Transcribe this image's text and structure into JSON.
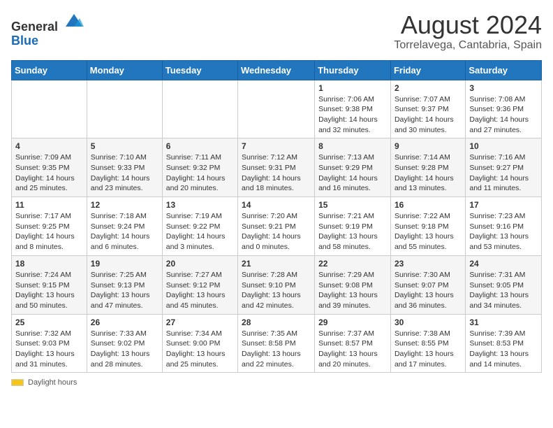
{
  "logo": {
    "general": "General",
    "blue": "Blue"
  },
  "title": "August 2024",
  "subtitle": "Torrelavega, Cantabria, Spain",
  "headers": [
    "Sunday",
    "Monday",
    "Tuesday",
    "Wednesday",
    "Thursday",
    "Friday",
    "Saturday"
  ],
  "footer": {
    "daylight_label": "Daylight hours"
  },
  "weeks": [
    [
      {
        "day": "",
        "info": ""
      },
      {
        "day": "",
        "info": ""
      },
      {
        "day": "",
        "info": ""
      },
      {
        "day": "",
        "info": ""
      },
      {
        "day": "1",
        "info": "Sunrise: 7:06 AM\nSunset: 9:38 PM\nDaylight: 14 hours\nand 32 minutes."
      },
      {
        "day": "2",
        "info": "Sunrise: 7:07 AM\nSunset: 9:37 PM\nDaylight: 14 hours\nand 30 minutes."
      },
      {
        "day": "3",
        "info": "Sunrise: 7:08 AM\nSunset: 9:36 PM\nDaylight: 14 hours\nand 27 minutes."
      }
    ],
    [
      {
        "day": "4",
        "info": "Sunrise: 7:09 AM\nSunset: 9:35 PM\nDaylight: 14 hours\nand 25 minutes."
      },
      {
        "day": "5",
        "info": "Sunrise: 7:10 AM\nSunset: 9:33 PM\nDaylight: 14 hours\nand 23 minutes."
      },
      {
        "day": "6",
        "info": "Sunrise: 7:11 AM\nSunset: 9:32 PM\nDaylight: 14 hours\nand 20 minutes."
      },
      {
        "day": "7",
        "info": "Sunrise: 7:12 AM\nSunset: 9:31 PM\nDaylight: 14 hours\nand 18 minutes."
      },
      {
        "day": "8",
        "info": "Sunrise: 7:13 AM\nSunset: 9:29 PM\nDaylight: 14 hours\nand 16 minutes."
      },
      {
        "day": "9",
        "info": "Sunrise: 7:14 AM\nSunset: 9:28 PM\nDaylight: 14 hours\nand 13 minutes."
      },
      {
        "day": "10",
        "info": "Sunrise: 7:16 AM\nSunset: 9:27 PM\nDaylight: 14 hours\nand 11 minutes."
      }
    ],
    [
      {
        "day": "11",
        "info": "Sunrise: 7:17 AM\nSunset: 9:25 PM\nDaylight: 14 hours\nand 8 minutes."
      },
      {
        "day": "12",
        "info": "Sunrise: 7:18 AM\nSunset: 9:24 PM\nDaylight: 14 hours\nand 6 minutes."
      },
      {
        "day": "13",
        "info": "Sunrise: 7:19 AM\nSunset: 9:22 PM\nDaylight: 14 hours\nand 3 minutes."
      },
      {
        "day": "14",
        "info": "Sunrise: 7:20 AM\nSunset: 9:21 PM\nDaylight: 14 hours\nand 0 minutes."
      },
      {
        "day": "15",
        "info": "Sunrise: 7:21 AM\nSunset: 9:19 PM\nDaylight: 13 hours\nand 58 minutes."
      },
      {
        "day": "16",
        "info": "Sunrise: 7:22 AM\nSunset: 9:18 PM\nDaylight: 13 hours\nand 55 minutes."
      },
      {
        "day": "17",
        "info": "Sunrise: 7:23 AM\nSunset: 9:16 PM\nDaylight: 13 hours\nand 53 minutes."
      }
    ],
    [
      {
        "day": "18",
        "info": "Sunrise: 7:24 AM\nSunset: 9:15 PM\nDaylight: 13 hours\nand 50 minutes."
      },
      {
        "day": "19",
        "info": "Sunrise: 7:25 AM\nSunset: 9:13 PM\nDaylight: 13 hours\nand 47 minutes."
      },
      {
        "day": "20",
        "info": "Sunrise: 7:27 AM\nSunset: 9:12 PM\nDaylight: 13 hours\nand 45 minutes."
      },
      {
        "day": "21",
        "info": "Sunrise: 7:28 AM\nSunset: 9:10 PM\nDaylight: 13 hours\nand 42 minutes."
      },
      {
        "day": "22",
        "info": "Sunrise: 7:29 AM\nSunset: 9:08 PM\nDaylight: 13 hours\nand 39 minutes."
      },
      {
        "day": "23",
        "info": "Sunrise: 7:30 AM\nSunset: 9:07 PM\nDaylight: 13 hours\nand 36 minutes."
      },
      {
        "day": "24",
        "info": "Sunrise: 7:31 AM\nSunset: 9:05 PM\nDaylight: 13 hours\nand 34 minutes."
      }
    ],
    [
      {
        "day": "25",
        "info": "Sunrise: 7:32 AM\nSunset: 9:03 PM\nDaylight: 13 hours\nand 31 minutes."
      },
      {
        "day": "26",
        "info": "Sunrise: 7:33 AM\nSunset: 9:02 PM\nDaylight: 13 hours\nand 28 minutes."
      },
      {
        "day": "27",
        "info": "Sunrise: 7:34 AM\nSunset: 9:00 PM\nDaylight: 13 hours\nand 25 minutes."
      },
      {
        "day": "28",
        "info": "Sunrise: 7:35 AM\nSunset: 8:58 PM\nDaylight: 13 hours\nand 22 minutes."
      },
      {
        "day": "29",
        "info": "Sunrise: 7:37 AM\nSunset: 8:57 PM\nDaylight: 13 hours\nand 20 minutes."
      },
      {
        "day": "30",
        "info": "Sunrise: 7:38 AM\nSunset: 8:55 PM\nDaylight: 13 hours\nand 17 minutes."
      },
      {
        "day": "31",
        "info": "Sunrise: 7:39 AM\nSunset: 8:53 PM\nDaylight: 13 hours\nand 14 minutes."
      }
    ]
  ]
}
